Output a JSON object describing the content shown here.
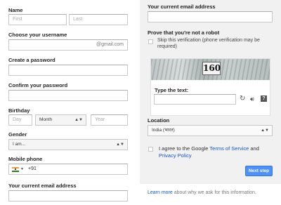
{
  "left": {
    "name_label": "Name",
    "first_placeholder": "First",
    "last_placeholder": "Last",
    "username_label": "Choose your username",
    "username_suffix": "@gmail.com",
    "password_label": "Create a password",
    "confirm_label": "Confirm your password",
    "birthday_label": "Birthday",
    "day_placeholder": "Day",
    "month_value": "Month",
    "year_placeholder": "Year",
    "gender_label": "Gender",
    "gender_value": "I am...",
    "mobile_label": "Mobile phone",
    "country_code": "+91",
    "email_label": "Your current email address"
  },
  "right": {
    "email_label": "Your current email address",
    "robot_label": "Prove that you're not a robot",
    "skip_text": "Skip this verification (phone verification may be required)",
    "captcha_text": "160",
    "type_text_label": "Type the text:",
    "location_label": "Location",
    "location_value": "India (भारत)",
    "agree_prefix": "I agree to the Google ",
    "terms_link": "Terms of Service",
    "agree_and": " and",
    "privacy_link": "Privacy Policy",
    "next_button": "Next step",
    "learn_more_link": "Learn more",
    "learn_more_rest": " about why we ask for this information."
  },
  "colors": {
    "accent": "#4d90fe",
    "link": "#1155cc",
    "panel": "#f1f1f1"
  }
}
